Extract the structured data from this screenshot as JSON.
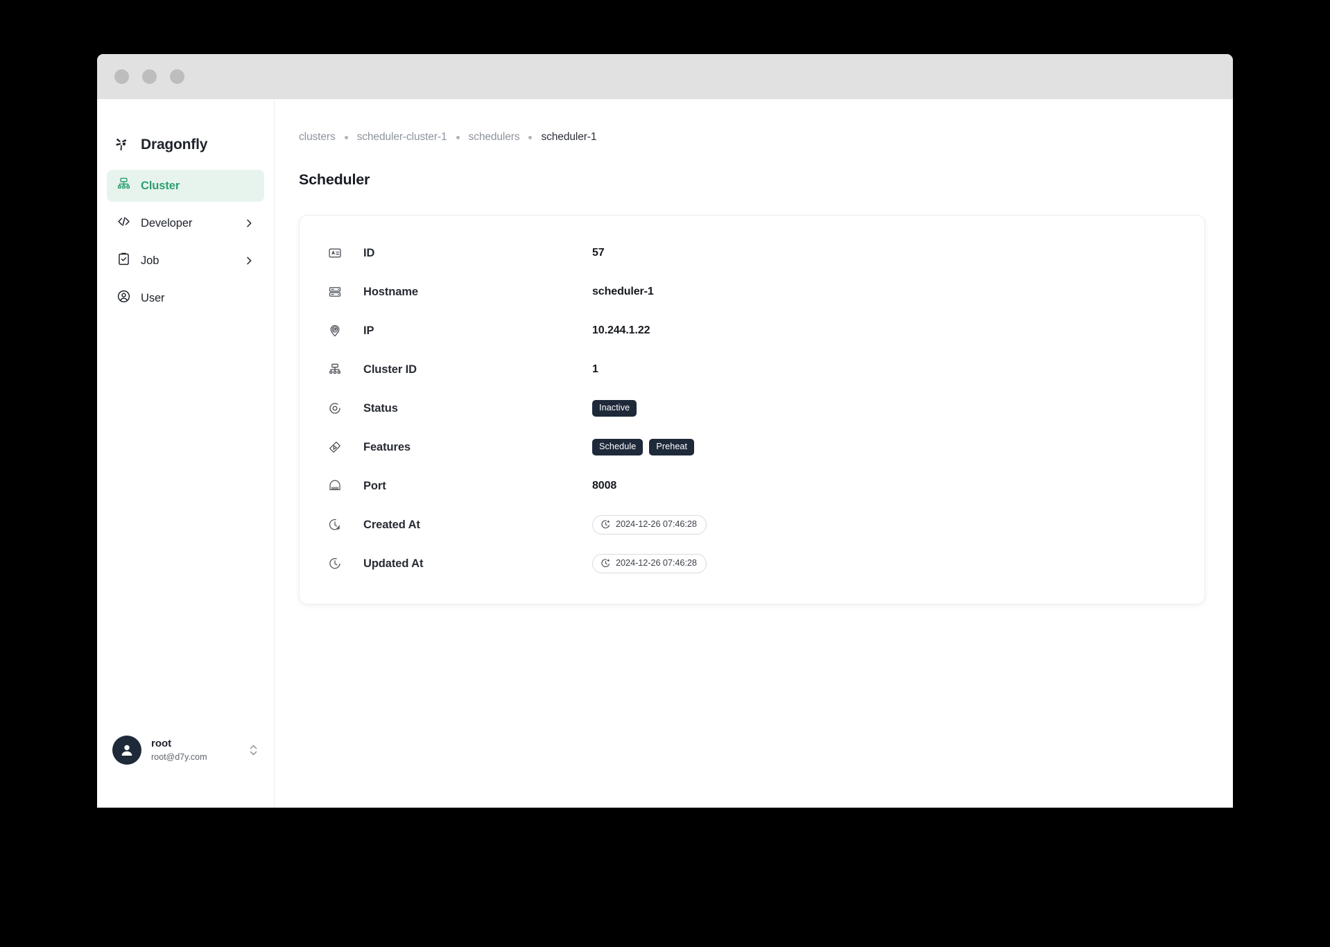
{
  "window": {
    "traffic_lights": [
      "close",
      "minimize",
      "zoom"
    ]
  },
  "sidebar": {
    "brand": {
      "name": "Dragonfly",
      "logo_icon": "dragonfly-logo-icon"
    },
    "items": [
      {
        "label": "Cluster",
        "icon": "cluster-icon",
        "active": true,
        "expandable": false
      },
      {
        "label": "Developer",
        "icon": "code-icon",
        "active": false,
        "expandable": true
      },
      {
        "label": "Job",
        "icon": "clipboard-check-icon",
        "active": false,
        "expandable": true
      },
      {
        "label": "User",
        "icon": "user-circle-icon",
        "active": false,
        "expandable": false
      }
    ],
    "user": {
      "name": "root",
      "email": "root@d7y.com",
      "avatar_icon": "person-avatar-icon",
      "switch_icon": "chevron-up-down-icon"
    }
  },
  "main": {
    "breadcrumb": [
      {
        "label": "clusters",
        "current": false
      },
      {
        "label": "scheduler-cluster-1",
        "current": false
      },
      {
        "label": "schedulers",
        "current": false
      },
      {
        "label": "scheduler-1",
        "current": true
      }
    ],
    "page_title": "Scheduler",
    "details": [
      {
        "icon": "id-card-icon",
        "label": "ID",
        "type": "text",
        "value": "57"
      },
      {
        "icon": "server-icon",
        "label": "Hostname",
        "type": "text",
        "value": "scheduler-1"
      },
      {
        "icon": "ip-pin-icon",
        "label": "IP",
        "type": "text",
        "value": "10.244.1.22"
      },
      {
        "icon": "cluster-icon",
        "label": "Cluster ID",
        "type": "text",
        "value": "1"
      },
      {
        "icon": "status-circle-icon",
        "label": "Status",
        "type": "badges",
        "badges": [
          "Inactive"
        ]
      },
      {
        "icon": "features-tag-icon",
        "label": "Features",
        "type": "badges",
        "badges": [
          "Schedule",
          "Preheat"
        ]
      },
      {
        "icon": "port-icon",
        "label": "Port",
        "type": "text",
        "value": "8008"
      },
      {
        "icon": "clock-plus-icon",
        "label": "Created At",
        "type": "time",
        "value": "2024-12-26 07:46:28"
      },
      {
        "icon": "clock-icon",
        "label": "Updated At",
        "type": "time",
        "value": "2024-12-26 07:46:28"
      }
    ]
  },
  "colors": {
    "accent": "#2e9e6f",
    "accent_bg": "#e7f4ee",
    "badge_bg": "#1e2939",
    "text": "#20242c",
    "muted": "#8d939d"
  }
}
